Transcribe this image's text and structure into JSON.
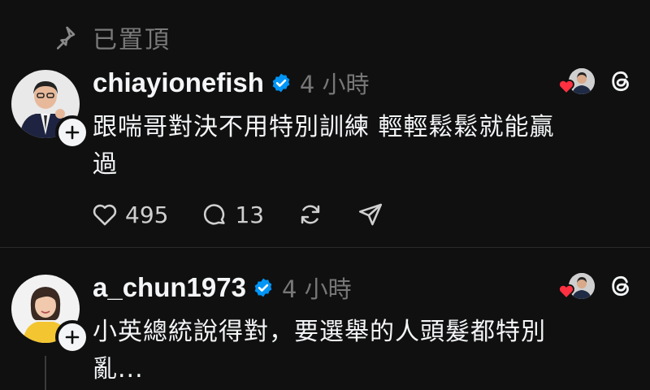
{
  "pinned": {
    "icon": "pin-icon",
    "label": "已置頂"
  },
  "posts": [
    {
      "username": "chiayionefish",
      "verified": true,
      "timestamp": "4 小時",
      "text": "跟喘哥對決不用特別訓練 輕輕鬆鬆就能贏\n過",
      "likes": "495",
      "replies": "13",
      "activity_icon": "liked-by-avatar-icon"
    },
    {
      "username": "a_chun1973",
      "verified": true,
      "timestamp": "4 小時",
      "text": "小英總統說得對，要選舉的人頭髮都特別\n亂...",
      "activity_icon": "liked-by-avatar-icon"
    }
  ],
  "colors": {
    "background": "#101010",
    "verified_blue": "#0095f6",
    "heart_red": "#ff3040",
    "muted": "#777777"
  }
}
